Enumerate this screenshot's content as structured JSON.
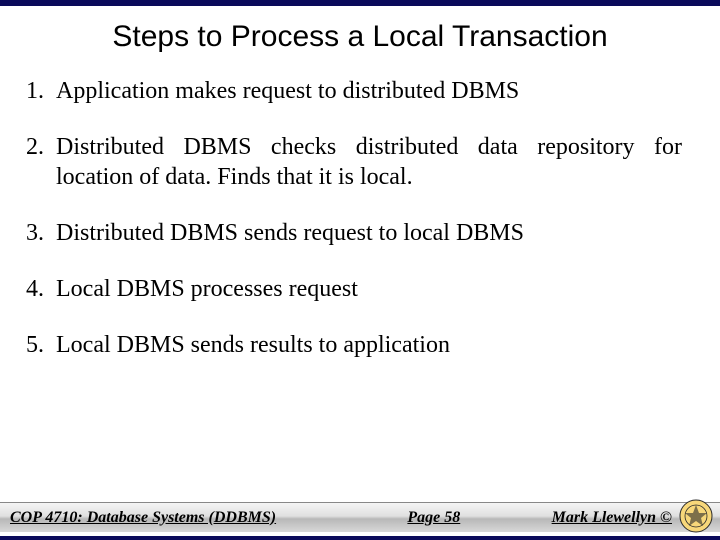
{
  "title": "Steps to Process a Local Transaction",
  "steps": [
    {
      "n": "1.",
      "text": "Application makes request to distributed DBMS"
    },
    {
      "n": "2.",
      "text": "Distributed DBMS checks distributed data repository for location of data. Finds that it is local."
    },
    {
      "n": "3.",
      "text": "Distributed DBMS sends request to local DBMS"
    },
    {
      "n": "4.",
      "text": "Local DBMS processes request"
    },
    {
      "n": "5.",
      "text": "Local DBMS sends results to application"
    }
  ],
  "footer": {
    "left": "COP 4710: Database Systems  (DDBMS)",
    "mid": "Page 58",
    "right": "Mark Llewellyn ©"
  },
  "icon": "ucf-seal"
}
